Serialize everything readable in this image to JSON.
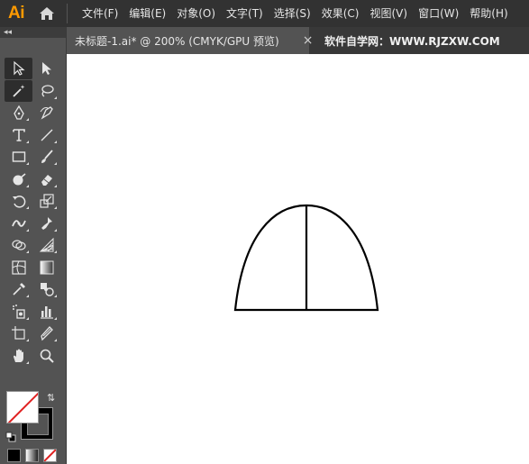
{
  "app": {
    "logo": "Ai",
    "accent": "#ff9a00"
  },
  "menu": {
    "items": [
      "文件(F)",
      "编辑(E)",
      "对象(O)",
      "文字(T)",
      "选择(S)",
      "效果(C)",
      "视图(V)",
      "窗口(W)",
      "帮助(H)"
    ]
  },
  "tabs": {
    "document": "未标题-1.ai* @ 200% (CMYK/GPU 预览)",
    "close": "×",
    "other": "软件自学网：WWW.RJZXW.COM"
  },
  "toolpanel": {
    "collapse": "◂◂"
  },
  "tools": [
    [
      "selection-tool-icon",
      "direct-selection-tool-icon"
    ],
    [
      "magic-wand-tool-icon",
      "lasso-tool-icon"
    ],
    [
      "pen-tool-icon",
      "curvature-tool-icon"
    ],
    [
      "type-tool-icon",
      "line-segment-tool-icon"
    ],
    [
      "rectangle-tool-icon",
      "paintbrush-tool-icon"
    ],
    [
      "shaper-tool-icon",
      "eraser-tool-icon"
    ],
    [
      "rotate-tool-icon",
      "scale-tool-icon"
    ],
    [
      "width-tool-icon",
      "puppet-warp-tool-icon"
    ],
    [
      "shape-builder-tool-icon",
      "perspective-grid-tool-icon"
    ],
    [
      "mesh-tool-icon",
      "gradient-tool-icon"
    ],
    [
      "eyedropper-tool-icon",
      "blend-tool-icon"
    ],
    [
      "symbol-sprayer-tool-icon",
      "column-graph-tool-icon"
    ],
    [
      "artboard-tool-icon",
      "slice-tool-icon"
    ],
    [
      "hand-tool-icon",
      "zoom-tool-icon"
    ]
  ],
  "colors": {
    "fill": "none",
    "stroke": "#000000",
    "none_slash": "#e02020"
  }
}
